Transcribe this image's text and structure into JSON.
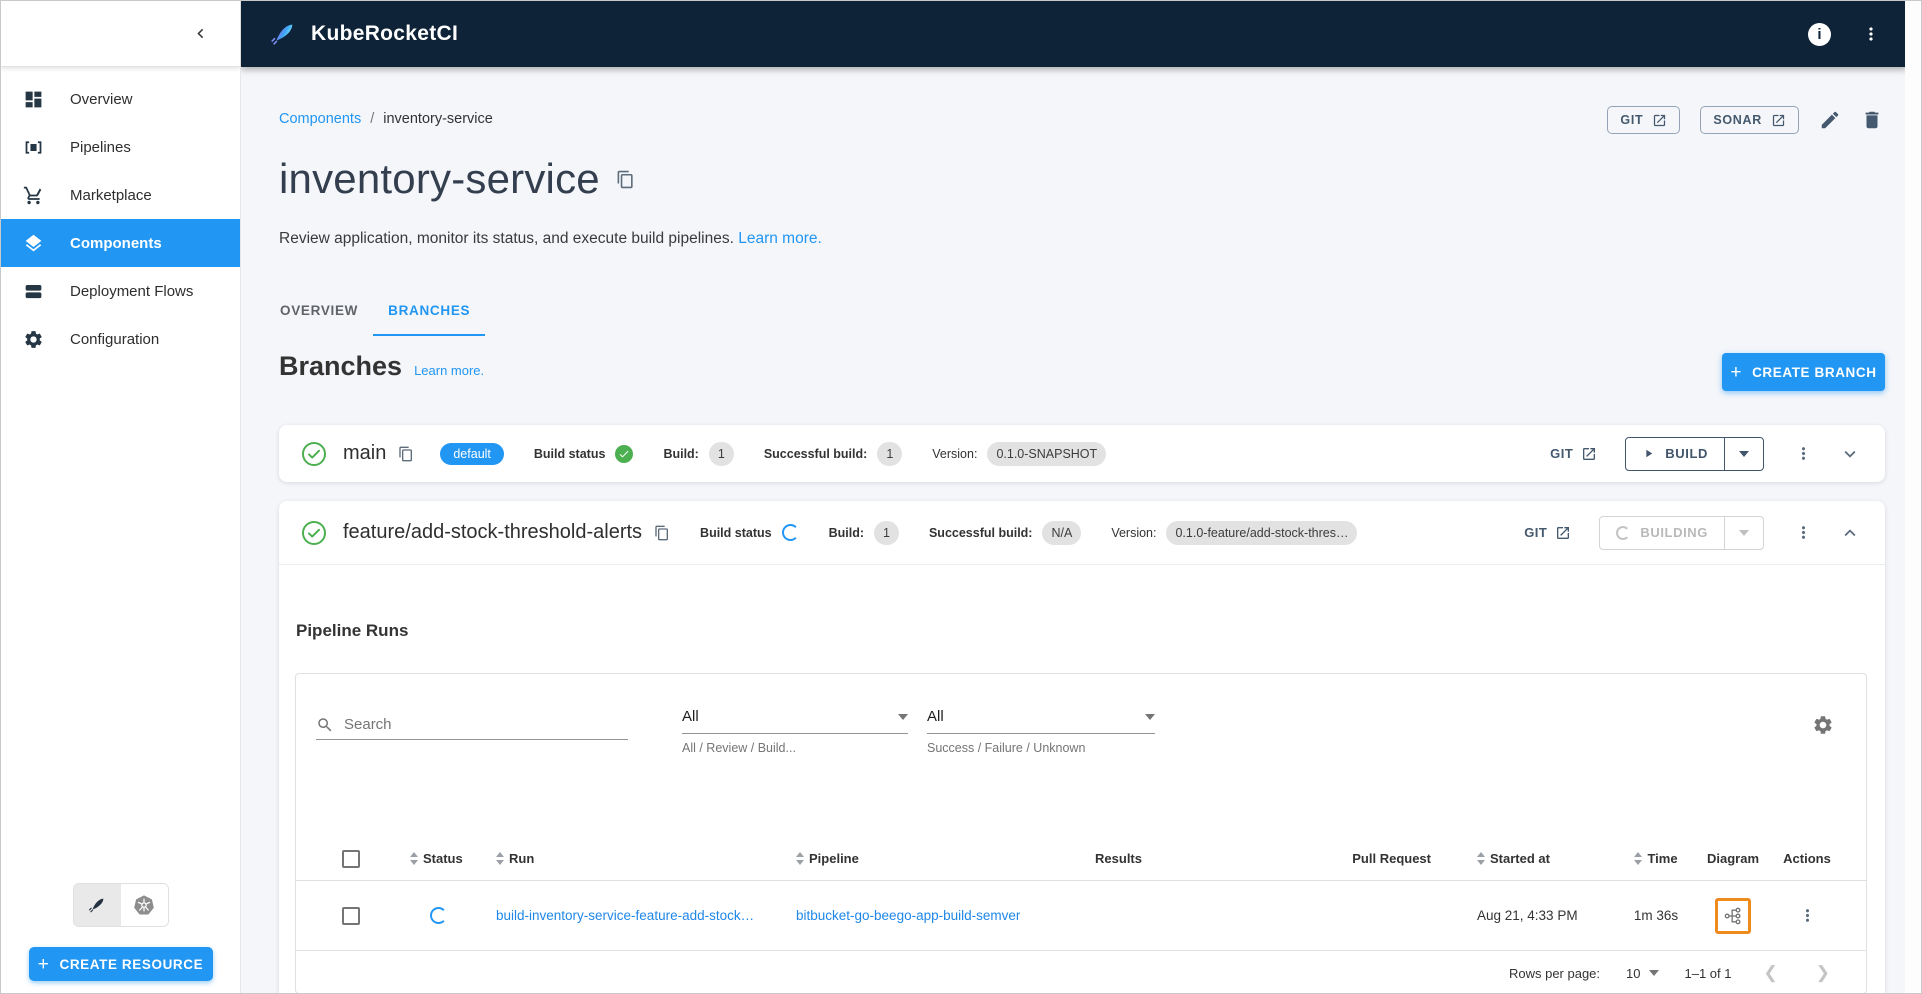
{
  "header": {
    "logo_text": "KubeRocketCI"
  },
  "sidebar": {
    "items": [
      {
        "label": "Overview"
      },
      {
        "label": "Pipelines"
      },
      {
        "label": "Marketplace"
      },
      {
        "label": "Components"
      },
      {
        "label": "Deployment Flows"
      },
      {
        "label": "Configuration"
      }
    ],
    "active_item": "Components",
    "create_resource_label": "CREATE RESOURCE"
  },
  "breadcrumb": {
    "parent": "Components",
    "separator": "/",
    "current": "inventory-service"
  },
  "page_actions": {
    "git_label": "GIT",
    "sonar_label": "SONAR"
  },
  "page": {
    "title": "inventory-service",
    "description": "Review application, monitor its status, and execute build pipelines.",
    "learn_more": "Learn more."
  },
  "tabs": [
    {
      "label": "OVERVIEW"
    },
    {
      "label": "BRANCHES"
    }
  ],
  "branches": {
    "heading": "Branches",
    "learn_more": "Learn more.",
    "create_branch_label": "CREATE BRANCH",
    "labels": {
      "default_badge": "default",
      "build_status": "Build status",
      "build": "Build:",
      "successful_build": "Successful build:",
      "version": "Version:",
      "git": "GIT"
    },
    "items": [
      {
        "name": "main",
        "build_count": "1",
        "successful_build": "1",
        "version": "0.1.0-SNAPSHOT",
        "action_label": "BUILD",
        "build_status": "success",
        "expanded": false
      },
      {
        "name": "feature/add-stock-threshold-alerts",
        "build_count": "1",
        "successful_build": "N/A",
        "version": "0.1.0-feature/add-stock-thres…",
        "action_label": "BUILDING",
        "build_status": "building",
        "expanded": true
      }
    ]
  },
  "pipeline_runs": {
    "heading": "Pipeline Runs",
    "filters": {
      "search_placeholder": "Search",
      "status_filter": {
        "value": "All",
        "helper": "All / Review / Build..."
      },
      "result_filter": {
        "value": "All",
        "helper": "Success / Failure / Unknown"
      }
    },
    "table": {
      "columns": [
        "Status",
        "Run",
        "Pipeline",
        "Results",
        "Pull Request",
        "Started at",
        "Time",
        "Diagram",
        "Actions"
      ],
      "rows": [
        {
          "run": "build-inventory-service-feature-add-stock…",
          "pipeline": "bitbucket-go-beego-app-build-semver",
          "results": "",
          "pull_request": "",
          "started_at": "Aug 21, 4:33 PM",
          "time": "1m 36s",
          "status": "running"
        }
      ]
    },
    "pagination": {
      "rows_per_page_label": "Rows per page:",
      "rows_per_page_value": "10",
      "range": "1–1 of 1"
    }
  },
  "colors": {
    "accent_blue": "#2196f3",
    "header_navy": "#0e2337",
    "success_green": "#4caf50",
    "slate": "#44586e",
    "highlight_orange": "#ef8a1c",
    "content_bg": "#f5f6fa"
  },
  "icons": [
    "collapse-sidebar",
    "info",
    "kebab-menu",
    "external-link",
    "edit",
    "delete",
    "copy",
    "search",
    "settings-gear",
    "sort",
    "diagram-tree",
    "play",
    "dropdown-caret",
    "chevron-down",
    "chevron-up",
    "check-circle",
    "spinner",
    "rocket-logo",
    "kubernetes-wheel",
    "plus",
    "shopping-cart",
    "layers",
    "gear",
    "dashboard"
  ]
}
